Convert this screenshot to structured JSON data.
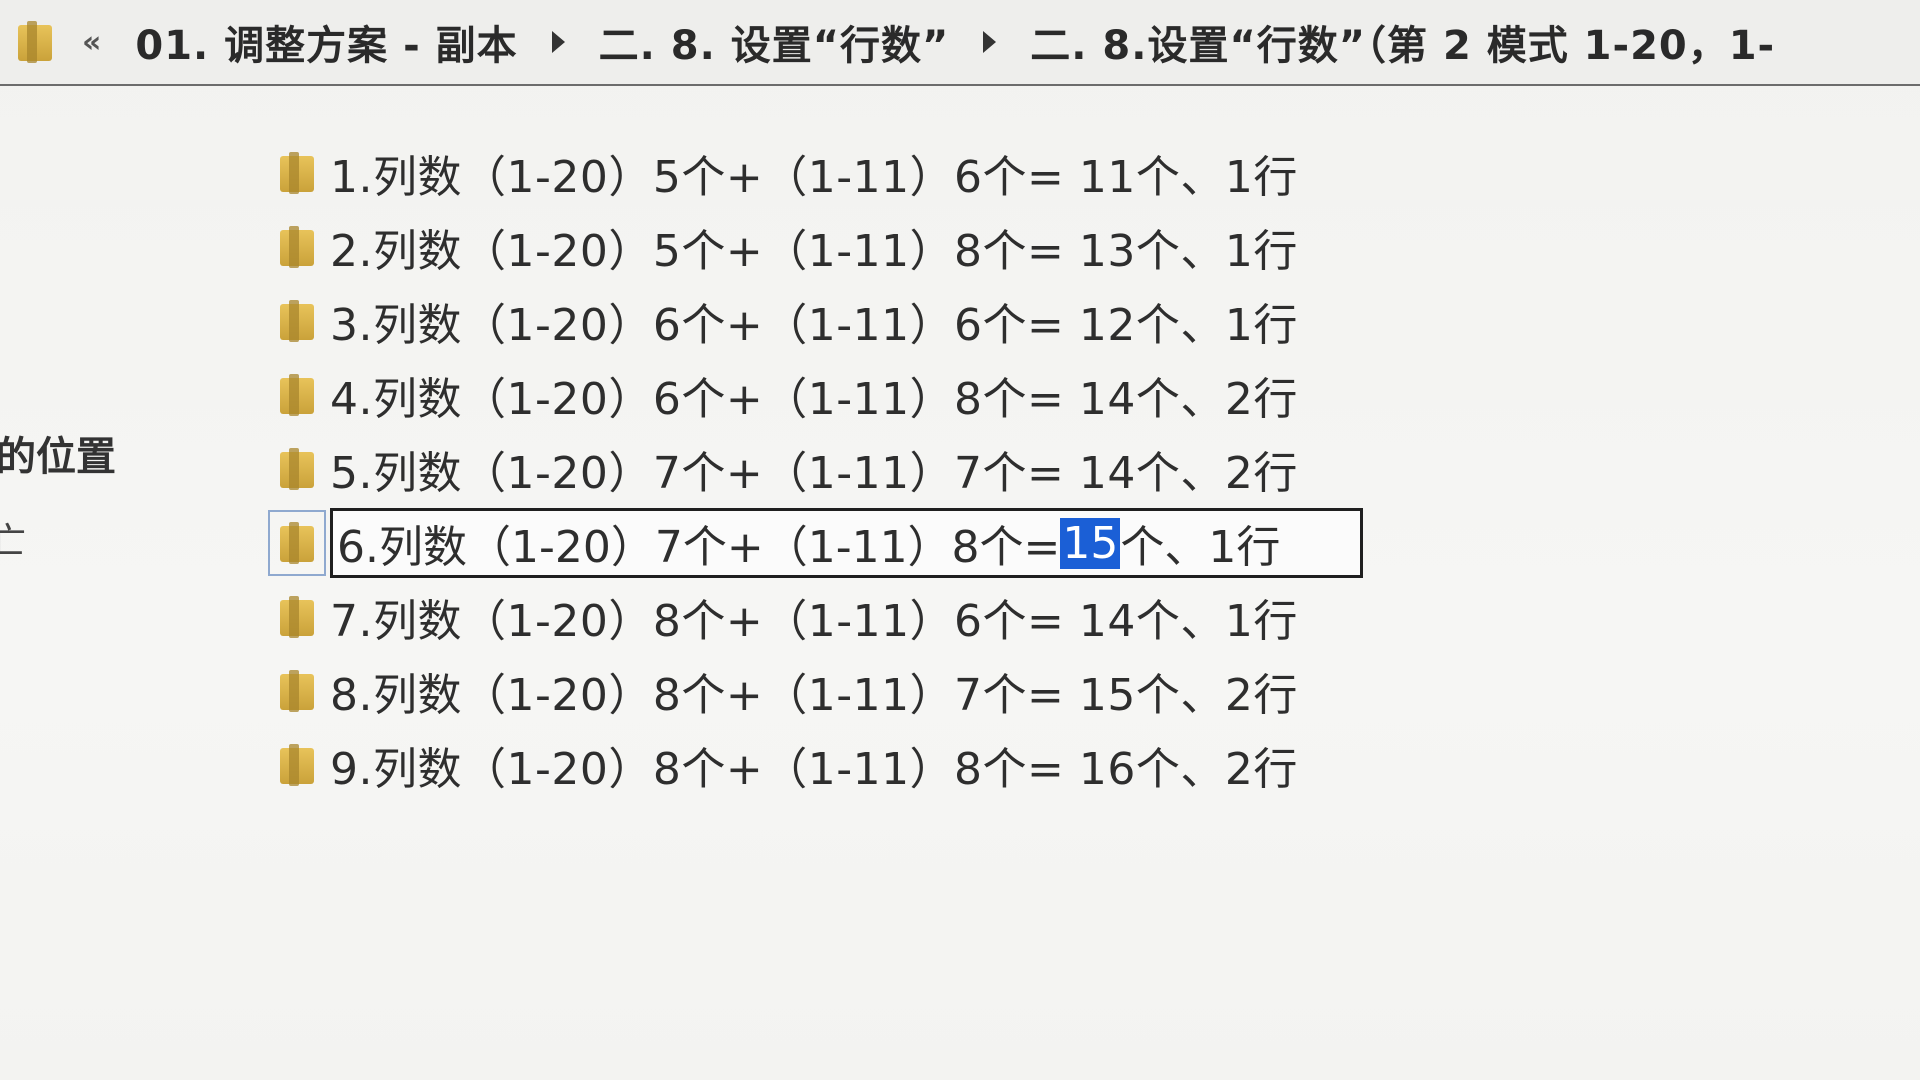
{
  "addressbar": {
    "nav_chevrons": "«",
    "crumbs": [
      "01. 调整方案 - 副本",
      "二. 8. 设置“行数”",
      "二. 8.设置“行数”（第 2 模式 1-20，1-"
    ]
  },
  "side": {
    "text": "的位置",
    "mark": "亡"
  },
  "files": [
    {
      "name": "1.列数（1-20）5个+（1-11）6个= 11个、1行"
    },
    {
      "name": "2.列数（1-20）5个+（1-11）8个= 13个、1行"
    },
    {
      "name": "3.列数（1-20）6个+（1-11）6个= 12个、1行"
    },
    {
      "name": "4.列数（1-20）6个+（1-11）8个= 14个、2行"
    },
    {
      "name": "5.列数（1-20）7个+（1-11）7个= 14个、2行"
    },
    {
      "name": "",
      "rename": {
        "before": "6.列数（1-20）7个+（1-11）8个= ",
        "selected": "15",
        "after": "个、1行"
      }
    },
    {
      "name": "7.列数（1-20）8个+（1-11）6个= 14个、1行"
    },
    {
      "name": "8.列数（1-20）8个+（1-11）7个= 15个、2行"
    },
    {
      "name": "9.列数（1-20）8个+（1-11）8个= 16个、2行"
    }
  ],
  "colors": {
    "folder": "#d4ad45",
    "selection": "#1b5fd6",
    "background": "#f4f4f2"
  },
  "icons": {
    "folder": "folder-icon"
  }
}
